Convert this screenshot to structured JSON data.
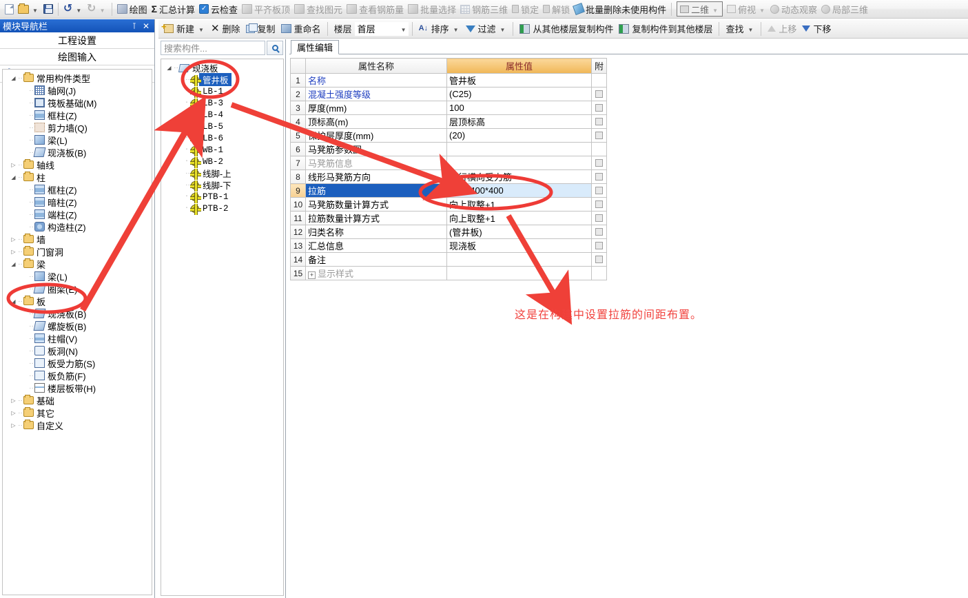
{
  "toolbar_main": {
    "items": [
      {
        "label": "",
        "icon": "new-file-icon",
        "type": "icon",
        "dim": false
      },
      {
        "label": "",
        "icon": "open-folder-icon",
        "type": "icon",
        "dim": false,
        "caret": true
      },
      {
        "label": "",
        "icon": "save-icon",
        "type": "icon",
        "dim": false
      },
      {
        "label": "",
        "icon": "undo-icon",
        "type": "icon",
        "dim": false,
        "caret": true
      },
      {
        "label": "",
        "icon": "redo-icon",
        "type": "icon",
        "dim": true,
        "caret": true
      },
      {
        "label": "绘图",
        "icon": "draw-icon",
        "dim": false
      },
      {
        "label": "汇总计算",
        "icon": "sigma-icon",
        "dim": false
      },
      {
        "label": "云检查",
        "icon": "cloud-check-icon",
        "dim": false
      },
      {
        "label": "平齐板顶",
        "icon": "align-slab-top-icon",
        "dim": true
      },
      {
        "label": "查找图元",
        "icon": "find-element-icon",
        "dim": true
      },
      {
        "label": "查看钢筋量",
        "icon": "view-rebar-qty-icon",
        "dim": true
      },
      {
        "label": "批量选择",
        "icon": "batch-select-icon",
        "dim": true
      },
      {
        "label": "钢筋三维",
        "icon": "rebar-3d-icon",
        "dim": true
      },
      {
        "label": "锁定",
        "icon": "lock-icon",
        "dim": true
      },
      {
        "label": "解锁",
        "icon": "unlock-icon",
        "dim": true
      },
      {
        "label": "批量删除未使用构件",
        "icon": "batch-delete-icon",
        "dim": false
      },
      {
        "label": "二维",
        "icon": "two-d-icon",
        "dim": true,
        "boxed": true,
        "caret": true
      },
      {
        "label": "俯视",
        "icon": "top-view-icon",
        "dim": true,
        "caret": true
      },
      {
        "label": "动态观察",
        "icon": "dynamic-observe-icon",
        "dim": true
      },
      {
        "label": "局部三维",
        "icon": "local-3d-icon",
        "dim": true
      }
    ]
  },
  "toolbar_component": {
    "items": [
      {
        "label": "新建",
        "icon": "new-component-icon",
        "dim": false,
        "caret": true
      },
      {
        "label": "删除",
        "icon": "delete-icon",
        "dim": false
      },
      {
        "label": "复制",
        "icon": "copy-icon",
        "dim": false
      },
      {
        "label": "重命名",
        "icon": "rename-icon",
        "dim": false
      }
    ],
    "floor_label": "楼层",
    "floor_value": "首层",
    "items2": [
      {
        "label": "排序",
        "icon": "sort-icon",
        "dim": false,
        "caret": true
      },
      {
        "label": "过滤",
        "icon": "filter-icon",
        "dim": false,
        "caret": true
      }
    ],
    "items3": [
      {
        "label": "从其他楼层复制构件",
        "icon": "copy-from-floor-icon",
        "dim": false
      },
      {
        "label": "复制构件到其他楼层",
        "icon": "copy-to-floor-icon",
        "dim": false
      }
    ],
    "find_label": "查找",
    "move_up_label": "上移",
    "move_down_label": "下移"
  },
  "left_panel": {
    "title": "模块导航栏",
    "pin_icon": "pin-icon",
    "close_icon": "close-icon",
    "buttons": [
      "工程设置",
      "绘图输入"
    ],
    "tools": [
      "expand-all-icon",
      "collapse-all-icon"
    ],
    "tree": [
      {
        "depth": 0,
        "label": "常用构件类型",
        "kind": "folder",
        "state": "expanded"
      },
      {
        "depth": 1,
        "label": "轴网(J)",
        "kind": "grid"
      },
      {
        "depth": 1,
        "label": "筏板基础(M)",
        "kind": "raft"
      },
      {
        "depth": 1,
        "label": "框柱(Z)",
        "kind": "col"
      },
      {
        "depth": 1,
        "label": "剪力墙(Q)",
        "kind": "wall"
      },
      {
        "depth": 1,
        "label": "梁(L)",
        "kind": "beam"
      },
      {
        "depth": 1,
        "label": "现浇板(B)",
        "kind": "slab"
      },
      {
        "depth": 0,
        "label": "轴线",
        "kind": "folder",
        "state": "collapsed"
      },
      {
        "depth": 0,
        "label": "柱",
        "kind": "folder",
        "state": "expanded"
      },
      {
        "depth": 1,
        "label": "框柱(Z)",
        "kind": "col"
      },
      {
        "depth": 1,
        "label": "暗柱(Z)",
        "kind": "col"
      },
      {
        "depth": 1,
        "label": "端柱(Z)",
        "kind": "col"
      },
      {
        "depth": 1,
        "label": "构造柱(Z)",
        "kind": "gz"
      },
      {
        "depth": 0,
        "label": "墙",
        "kind": "folder",
        "state": "collapsed"
      },
      {
        "depth": 0,
        "label": "门窗洞",
        "kind": "folder",
        "state": "collapsed"
      },
      {
        "depth": 0,
        "label": "梁",
        "kind": "folder",
        "state": "expanded"
      },
      {
        "depth": 1,
        "label": "梁(L)",
        "kind": "beam"
      },
      {
        "depth": 1,
        "label": "圈梁(E)",
        "kind": "slab"
      },
      {
        "depth": 0,
        "label": "板",
        "kind": "folder",
        "state": "expanded"
      },
      {
        "depth": 1,
        "label": "现浇板(B)",
        "kind": "slab",
        "highlighted": true
      },
      {
        "depth": 1,
        "label": "螺旋板(B)",
        "kind": "slab"
      },
      {
        "depth": 1,
        "label": "柱帽(V)",
        "kind": "cap"
      },
      {
        "depth": 1,
        "label": "板洞(N)",
        "kind": "hole"
      },
      {
        "depth": 1,
        "label": "板受力筋(S)",
        "kind": "rebar"
      },
      {
        "depth": 1,
        "label": "板负筋(F)",
        "kind": "rebar"
      },
      {
        "depth": 1,
        "label": "楼层板带(H)",
        "kind": "band"
      },
      {
        "depth": 0,
        "label": "基础",
        "kind": "folder",
        "state": "collapsed"
      },
      {
        "depth": 0,
        "label": "其它",
        "kind": "folder",
        "state": "collapsed"
      },
      {
        "depth": 0,
        "label": "自定义",
        "kind": "folder",
        "state": "collapsed"
      }
    ]
  },
  "component_panel": {
    "search_placeholder": "搜索构件...",
    "search_value": "",
    "search_icon": "magnifier-icon",
    "root": "现浇板",
    "items": [
      {
        "label": "管井板",
        "selected": true,
        "cjk": true
      },
      {
        "label": "LB-1",
        "selected": false
      },
      {
        "label": "LB-3",
        "selected": false
      },
      {
        "label": "LB-4",
        "selected": false
      },
      {
        "label": "LB-5",
        "selected": false
      },
      {
        "label": "LB-6",
        "selected": false
      },
      {
        "label": "WB-1",
        "selected": false
      },
      {
        "label": "WB-2",
        "selected": false
      },
      {
        "label": "线脚-上",
        "selected": false,
        "cjk": true
      },
      {
        "label": "线脚-下",
        "selected": false,
        "cjk": true
      },
      {
        "label": "PTB-1",
        "selected": false
      },
      {
        "label": "PTB-2",
        "selected": false
      }
    ]
  },
  "property_panel": {
    "tab": "属性编辑",
    "headers": {
      "index": "",
      "name": "属性名称",
      "value": "属性值",
      "attach": "附"
    },
    "rows": [
      {
        "n": "1",
        "name": "名称",
        "value": "管井板",
        "name_style": "blue",
        "attach": false,
        "selected": false
      },
      {
        "n": "2",
        "name": "混凝土强度等级",
        "value": "(C25)",
        "name_style": "blue",
        "attach": true,
        "selected": false
      },
      {
        "n": "3",
        "name": "厚度(mm)",
        "value": "100",
        "name_style": "",
        "attach": true,
        "selected": false
      },
      {
        "n": "4",
        "name": "顶标高(m)",
        "value": "层顶标高",
        "name_style": "",
        "attach": true,
        "selected": false
      },
      {
        "n": "5",
        "name": "保护层厚度(mm)",
        "value": "(20)",
        "name_style": "",
        "attach": true,
        "selected": false
      },
      {
        "n": "6",
        "name": "马凳筋参数图",
        "value": "",
        "name_style": "",
        "attach": false,
        "selected": false
      },
      {
        "n": "7",
        "name": "马凳筋信息",
        "value": "",
        "name_style": "gray",
        "attach": true,
        "selected": false
      },
      {
        "n": "8",
        "name": "线形马凳筋方向",
        "value": "平行横向受力筋",
        "name_style": "",
        "attach": true,
        "selected": false
      },
      {
        "n": "9",
        "name": "拉筋",
        "value": "Ф6@400*400",
        "name_style": "",
        "attach": true,
        "selected": true
      },
      {
        "n": "10",
        "name": "马凳筋数量计算方式",
        "value": "向上取整+1",
        "name_style": "",
        "attach": true,
        "selected": false
      },
      {
        "n": "11",
        "name": "拉筋数量计算方式",
        "value": "向上取整+1",
        "name_style": "",
        "attach": true,
        "selected": false
      },
      {
        "n": "12",
        "name": "归类名称",
        "value": "(管井板)",
        "name_style": "",
        "attach": true,
        "selected": false
      },
      {
        "n": "13",
        "name": "汇总信息",
        "value": "现浇板",
        "name_style": "",
        "attach": true,
        "selected": false
      },
      {
        "n": "14",
        "name": "备注",
        "value": "",
        "name_style": "",
        "attach": true,
        "selected": false
      },
      {
        "n": "15",
        "name": "显示样式",
        "value": "",
        "name_style": "gray",
        "attach": false,
        "selected": false,
        "expandable": true,
        "expand_glyph": "+"
      }
    ]
  },
  "annotations": {
    "note_text": "这是在构建中设置拉筋的间距布置。",
    "note_color": "#f1433f",
    "ellipse_color": "#ee3b36",
    "arrow_color": "#ef4038"
  }
}
